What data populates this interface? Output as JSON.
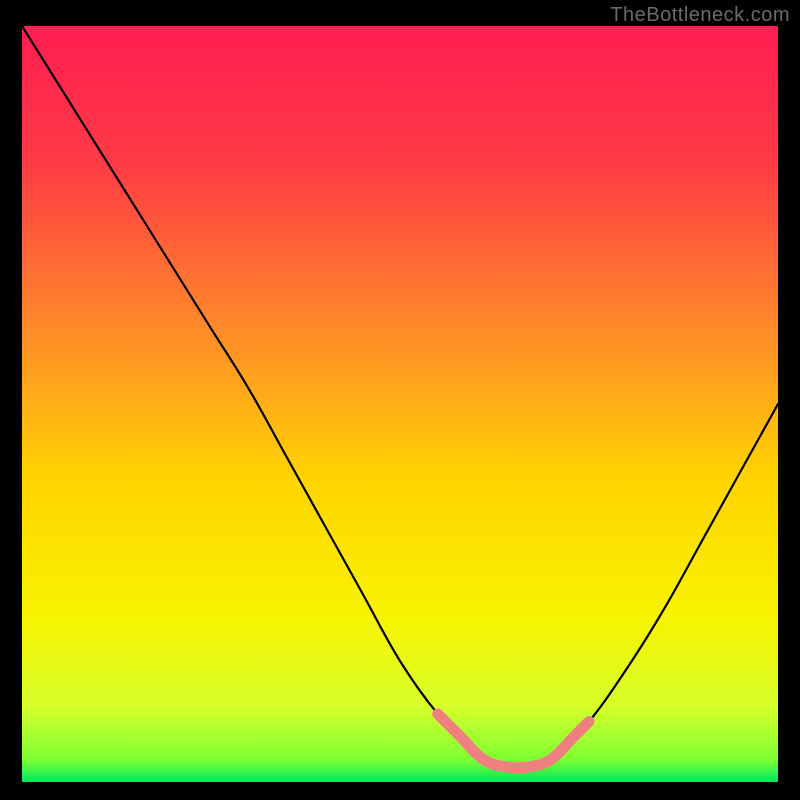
{
  "watermark": "TheBottleneck.com",
  "chart_data": {
    "type": "line",
    "title": "",
    "xlabel": "",
    "ylabel": "",
    "xlim": [
      0,
      100
    ],
    "ylim": [
      0,
      100
    ],
    "grid": false,
    "legend": false,
    "background_gradient": {
      "top_color": "#ff1e52",
      "mid_color": "#ffd400",
      "bottom_color": "#00e85b"
    },
    "series": [
      {
        "name": "bottleneck-curve",
        "color": "#000000",
        "x": [
          0,
          5,
          10,
          15,
          20,
          25,
          30,
          35,
          40,
          45,
          50,
          55,
          60,
          63,
          66,
          70,
          75,
          80,
          85,
          90,
          95,
          100
        ],
        "y": [
          100,
          92,
          84,
          76,
          68,
          60,
          52,
          43,
          34,
          25,
          16,
          9,
          4,
          2,
          2,
          3,
          8,
          15,
          23,
          32,
          41,
          50
        ]
      },
      {
        "name": "good-range-highlight",
        "color": "#f08080",
        "x": [
          55,
          58,
          61,
          64,
          67,
          70,
          73,
          75
        ],
        "y": [
          9,
          6,
          3,
          2,
          2,
          3,
          6,
          8
        ]
      }
    ]
  }
}
